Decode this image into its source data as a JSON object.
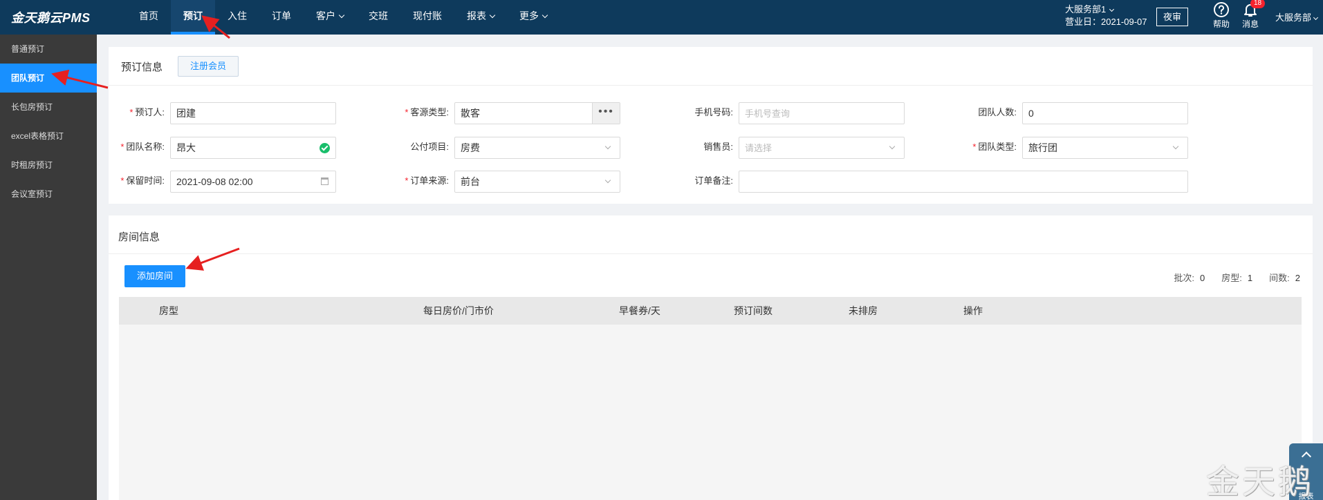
{
  "app": {
    "logo": "金天鹅云PMS"
  },
  "nav": {
    "items": [
      {
        "label": "首页",
        "dropdown": false
      },
      {
        "label": "预订",
        "dropdown": false,
        "active": true
      },
      {
        "label": "入住",
        "dropdown": false
      },
      {
        "label": "订单",
        "dropdown": false
      },
      {
        "label": "客户",
        "dropdown": true
      },
      {
        "label": "交班",
        "dropdown": false
      },
      {
        "label": "现付账",
        "dropdown": false
      },
      {
        "label": "报表",
        "dropdown": true
      },
      {
        "label": "更多",
        "dropdown": true
      }
    ]
  },
  "header": {
    "department": "大服务部1",
    "business_date": "营业日：2021-09-07",
    "night_audit": "夜审",
    "help": "帮助",
    "messages": "消息",
    "message_count": "18",
    "user": "大服务部"
  },
  "sidebar": {
    "items": [
      {
        "label": "普通预订"
      },
      {
        "label": "团队预订",
        "active": true
      },
      {
        "label": "长包房预订"
      },
      {
        "label": "excel表格预订"
      },
      {
        "label": "时租房预订"
      },
      {
        "label": "会议室预订"
      }
    ]
  },
  "booking": {
    "title": "预订信息",
    "register_member": "注册会员",
    "booker_label": "预订人:",
    "booker_value": "团建",
    "source_type_label": "客源类型:",
    "source_type_value": "散客",
    "phone_label": "手机号码:",
    "phone_placeholder": "手机号查询",
    "group_size_label": "团队人数:",
    "group_size_value": "0",
    "group_name_label": "团队名称:",
    "group_name_value": "昂大",
    "public_pay_label": "公付项目:",
    "public_pay_value": "房费",
    "sales_label": "销售员:",
    "sales_placeholder": "请选择",
    "group_type_label": "团队类型:",
    "group_type_value": "旅行团",
    "hold_time_label": "保留时间:",
    "hold_time_value": "2021-09-08 02:00",
    "order_source_label": "订单来源:",
    "order_source_value": "前台",
    "order_note_label": "订单备注:",
    "order_note_value": ""
  },
  "rooms": {
    "title": "房间信息",
    "add_room": "添加房间",
    "batch_label": "批次:",
    "batch_value": "0",
    "room_type_label": "房型:",
    "room_type_value": "1",
    "room_count_label": "间数:",
    "room_count_value": "2",
    "columns": [
      "房型",
      "每日房价/门市价",
      "早餐券/天",
      "预订间数",
      "未排房",
      "操作"
    ]
  },
  "float": {
    "label": "报表"
  },
  "watermark": "金天鹅"
}
